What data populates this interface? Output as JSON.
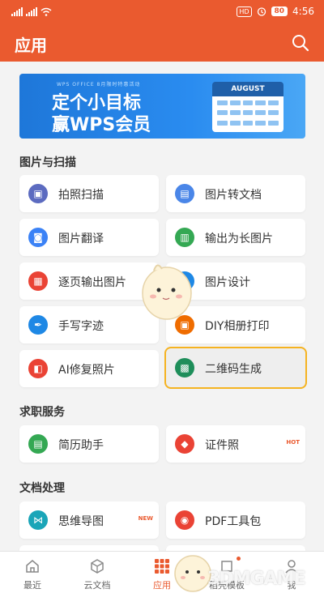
{
  "status": {
    "time": "4:56",
    "hd": "HD",
    "battery": "80"
  },
  "app": {
    "title": "应用"
  },
  "banner": {
    "tag": "WPS OFFICE 8月限时特惠活动",
    "line1": "定个小目标",
    "line2": "赢WPS会员",
    "month": "AUGUST"
  },
  "sections": {
    "image_scan": {
      "title": "图片与扫描",
      "items": [
        {
          "label": "拍照扫描",
          "icon": "camera-scan-icon",
          "color": "#5c6bc0"
        },
        {
          "label": "图片转文档",
          "icon": "image-to-doc-icon",
          "color": "#4a86e8"
        },
        {
          "label": "图片翻译",
          "icon": "image-translate-icon",
          "color": "#3b82f6"
        },
        {
          "label": "输出为长图片",
          "icon": "long-image-icon",
          "color": "#34a853"
        },
        {
          "label": "逐页输出图片",
          "icon": "page-image-icon",
          "color": "#ea4335"
        },
        {
          "label": "图片设计",
          "icon": "image-design-icon",
          "color": "#1e88e5"
        },
        {
          "label": "手写字迹",
          "icon": "handwriting-icon",
          "color": "#1e88e5"
        },
        {
          "label": "DIY相册打印",
          "icon": "album-print-icon",
          "color": "#ef6c00"
        },
        {
          "label": "AI修复照片",
          "icon": "ai-repair-icon",
          "color": "#ea4335"
        },
        {
          "label": "二维码生成",
          "icon": "qrcode-icon",
          "color": "#1e8e5a"
        }
      ]
    },
    "job": {
      "title": "求职服务",
      "items": [
        {
          "label": "简历助手",
          "icon": "resume-icon",
          "color": "#34a853",
          "badge": ""
        },
        {
          "label": "证件照",
          "icon": "id-photo-icon",
          "color": "#ea4335",
          "badge": "HOT"
        }
      ]
    },
    "docs": {
      "title": "文档处理",
      "items": [
        {
          "label": "思维导图",
          "icon": "mindmap-icon",
          "color": "#1aa5b8",
          "badge": "NEW"
        },
        {
          "label": "PDF工具包",
          "icon": "pdf-toolkit-icon",
          "color": "#ea4335",
          "badge": ""
        }
      ]
    }
  },
  "tabs": [
    {
      "label": "最近",
      "icon": "home-icon"
    },
    {
      "label": "云文档",
      "icon": "cloud-doc-icon"
    },
    {
      "label": "应用",
      "icon": "apps-grid-icon"
    },
    {
      "label": "稻壳模板",
      "icon": "template-icon"
    },
    {
      "label": "我",
      "icon": "profile-icon"
    }
  ],
  "watermark": "3DMGAME",
  "colors": {
    "brand": "#ea5a2f",
    "highlight": "#f5b321"
  }
}
